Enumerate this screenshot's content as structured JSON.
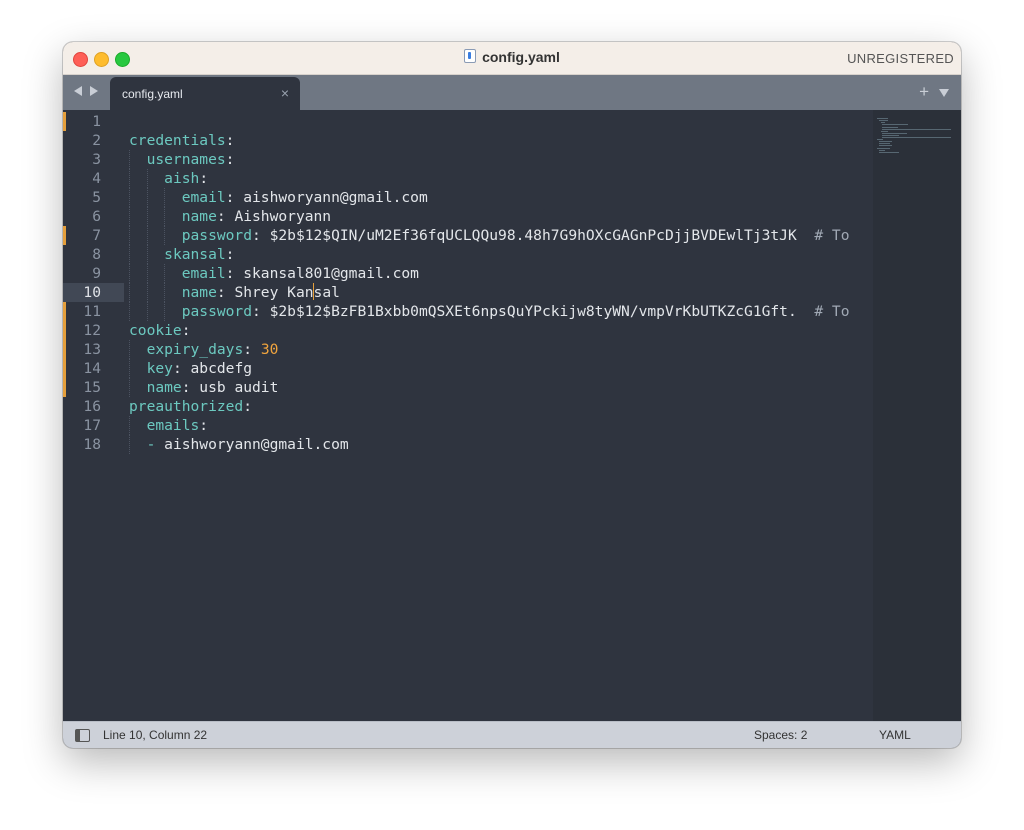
{
  "window": {
    "title": "config.yaml",
    "registration": "UNREGISTERED"
  },
  "tabs": [
    {
      "label": "config.yaml",
      "close": "×",
      "active": true
    }
  ],
  "tabbar": {
    "new_tab": "+"
  },
  "editor": {
    "language": "YAML",
    "current_line": 10,
    "lines": [
      {
        "n": "1",
        "tokens": []
      },
      {
        "n": "2",
        "tokens": [
          [
            "k",
            "credentials"
          ],
          [
            "p",
            ":"
          ]
        ]
      },
      {
        "n": "3",
        "tokens": [
          [
            "p",
            "  "
          ],
          [
            "k",
            "usernames"
          ],
          [
            "p",
            ":"
          ]
        ]
      },
      {
        "n": "4",
        "tokens": [
          [
            "p",
            "    "
          ],
          [
            "k",
            "aish"
          ],
          [
            "p",
            ":"
          ]
        ]
      },
      {
        "n": "5",
        "tokens": [
          [
            "p",
            "      "
          ],
          [
            "k",
            "email"
          ],
          [
            "p",
            ": aishworyann@gmail.com"
          ]
        ]
      },
      {
        "n": "6",
        "tokens": [
          [
            "p",
            "      "
          ],
          [
            "k",
            "name"
          ],
          [
            "p",
            ": Aishworyann"
          ]
        ]
      },
      {
        "n": "7",
        "tokens": [
          [
            "p",
            "      "
          ],
          [
            "k",
            "password"
          ],
          [
            "p",
            ": $2b$12$QIN/uM2Ef36fqUCLQQu98.48h7G9hOXcGAGnPcDjjBVDEwlTj3tJK  "
          ],
          [
            "c",
            "# To"
          ]
        ]
      },
      {
        "n": "8",
        "tokens": [
          [
            "p",
            "    "
          ],
          [
            "k",
            "skansal"
          ],
          [
            "p",
            ":"
          ]
        ]
      },
      {
        "n": "9",
        "tokens": [
          [
            "p",
            "      "
          ],
          [
            "k",
            "email"
          ],
          [
            "p",
            ": skansal801@gmail.com"
          ]
        ]
      },
      {
        "n": "10",
        "tokens": [
          [
            "p",
            "      "
          ],
          [
            "k",
            "name"
          ],
          [
            "p",
            ": Shrey Kan"
          ],
          [
            "caret",
            ""
          ],
          [
            "p",
            "sal"
          ]
        ]
      },
      {
        "n": "11",
        "tokens": [
          [
            "p",
            "      "
          ],
          [
            "k",
            "password"
          ],
          [
            "p",
            ": $2b$12$BzFB1Bxbb0mQSXEt6npsQuYPckijw8tyWN/vmpVrKbUTKZcG1Gft.  "
          ],
          [
            "c",
            "# To"
          ]
        ]
      },
      {
        "n": "12",
        "tokens": [
          [
            "k",
            "cookie"
          ],
          [
            "p",
            ":"
          ]
        ]
      },
      {
        "n": "13",
        "tokens": [
          [
            "p",
            "  "
          ],
          [
            "k",
            "expiry_days"
          ],
          [
            "p",
            ": "
          ],
          [
            "n",
            "30"
          ]
        ]
      },
      {
        "n": "14",
        "tokens": [
          [
            "p",
            "  "
          ],
          [
            "k",
            "key"
          ],
          [
            "p",
            ": abcdefg"
          ]
        ]
      },
      {
        "n": "15",
        "tokens": [
          [
            "p",
            "  "
          ],
          [
            "k",
            "name"
          ],
          [
            "p",
            ": usb audit"
          ]
        ]
      },
      {
        "n": "16",
        "tokens": [
          [
            "k",
            "preauthorized"
          ],
          [
            "p",
            ":"
          ]
        ]
      },
      {
        "n": "17",
        "tokens": [
          [
            "p",
            "  "
          ],
          [
            "k",
            "emails"
          ],
          [
            "p",
            ":"
          ]
        ]
      },
      {
        "n": "18",
        "tokens": [
          [
            "p",
            "  "
          ],
          [
            "k",
            "-"
          ],
          [
            "p",
            " aishworyann@gmail.com"
          ]
        ]
      }
    ],
    "modified_lines": [
      1,
      7,
      11,
      12,
      13,
      14,
      15
    ]
  },
  "statusbar": {
    "position": "Line 10, Column 22",
    "indentation": "Spaces: 2",
    "syntax": "YAML"
  },
  "colors": {
    "background": "#2f343f",
    "key": "#6cc9c0",
    "number": "#f0a43e",
    "text": "#e3e6ea",
    "gutter_modified": "#e6a03c"
  }
}
